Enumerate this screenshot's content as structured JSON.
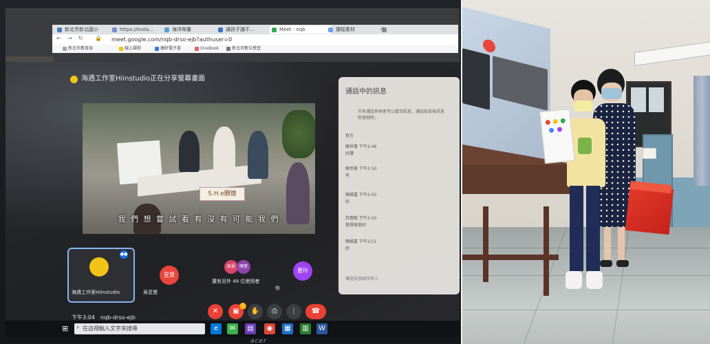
{
  "browser": {
    "tabs": [
      {
        "label": "新北市新北國小",
        "color": "#4a7ab5"
      },
      {
        "label": "https://insta...",
        "color": "#7b8cc6"
      },
      {
        "label": "海洋佈署",
        "color": "#5b9bd5"
      },
      {
        "label": "讓孩子讀不...",
        "color": "#3b73c4"
      },
      {
        "label": "Meet - nqb",
        "color": "#34a853",
        "active": true
      },
      {
        "label": "課程素材",
        "color": "#6d9eeb"
      }
    ],
    "url": "meet.google.com/nqb-drso-ejb?authuser=0",
    "bookmarks": [
      {
        "label": "新北市教育局",
        "color": "#9aa"
      },
      {
        "label": "線上課程",
        "color": "#f2c418"
      },
      {
        "label": "康軒電子書",
        "color": "#3c78d8"
      },
      {
        "label": "OneBook",
        "color": "#e06666"
      },
      {
        "label": "新北市數位學習",
        "color": "#777"
      }
    ]
  },
  "meet": {
    "presenter_banner": "海遇工作室Hiinstudio正在分享螢幕畫面",
    "subtitle": "我 們 想 嘗 試 看 有 沒 有 可 能 我 們",
    "sign_text": "S.H.e關懷",
    "side_panel": {
      "title": "通話中的訊息",
      "note": "只有通話參與者可以看到訊息，通話結束後訊息就會刪除。",
      "section": "留言",
      "messages": [
        {
          "name": "陳世豪  下午2:46",
          "text": "好讚"
        },
        {
          "name": "陳世豪  下午2:50",
          "text": "有"
        },
        {
          "name": "陳維嘉  下午2:50",
          "text": "好"
        },
        {
          "name": "許惠敏  下午2:50",
          "text": "覺得很美好"
        },
        {
          "name": "陳維嘉  下午2:51",
          "text": "好"
        }
      ],
      "input_placeholder": "傳送訊息給所有人"
    },
    "participants": [
      {
        "label": "海遇工作室Hiinstudio",
        "avatar": "",
        "color": "#f2c418"
      },
      {
        "label": "吳昱慧",
        "avatar": "昱慧",
        "color": "#e8453c"
      },
      {
        "label": "還有另外 49 位使用者",
        "avatar": "",
        "color": "#a142f4"
      },
      {
        "label": "你",
        "avatar": "惠玲",
        "color": "#a142f4"
      }
    ],
    "more_avatars": [
      "政慧",
      "陳瑩"
    ],
    "time": "下午3:04",
    "meeting_code": "nqb-drso-ejb",
    "notification_count": "2"
  },
  "taskbar": {
    "search_placeholder": "在這裡輸入文字來搜尋"
  },
  "laptop_brand": "acer",
  "colors": {
    "meet_red": "#ea4335",
    "meet_bg": "#202124",
    "gift_red": "#d92b1f"
  }
}
